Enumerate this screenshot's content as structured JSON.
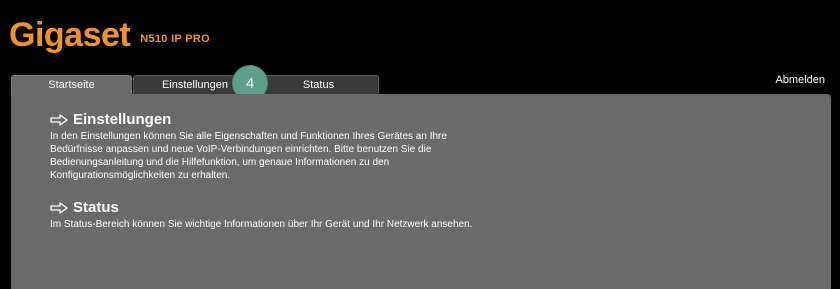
{
  "brand": {
    "logo": "Gigaset",
    "model": "N510 IP PRO"
  },
  "header": {
    "logout_label": "Abmelden"
  },
  "tabs": [
    {
      "label": "Startseite",
      "active": true
    },
    {
      "label": "Einstellungen",
      "active": false
    },
    {
      "label": "Status",
      "active": false
    }
  ],
  "badge": {
    "number": "4",
    "color": "#5e9e8c"
  },
  "sections": [
    {
      "icon": "arrow-right-icon",
      "title": "Einstellungen",
      "text": "In den Einstellungen können Sie alle Eigenschaften und Funktionen Ihres Gerätes an Ihre Bedürfnisse anpassen und neue VoIP-Verbindungen einrichten. Bitte benutzen Sie die Bedienungsanleitung und die Hilfefunktion, um genaue Informationen zu den Konfigurationsmöglichkeiten zu erhalten."
    },
    {
      "icon": "arrow-right-icon",
      "title": "Status",
      "text": "Im Status-Bereich können Sie wichtige Informationen über Ihr Gerät und Ihr Netzwerk ansehen."
    }
  ],
  "colors": {
    "brand_orange": "#f39325",
    "background": "#000000",
    "panel": "#6a6a6a"
  }
}
